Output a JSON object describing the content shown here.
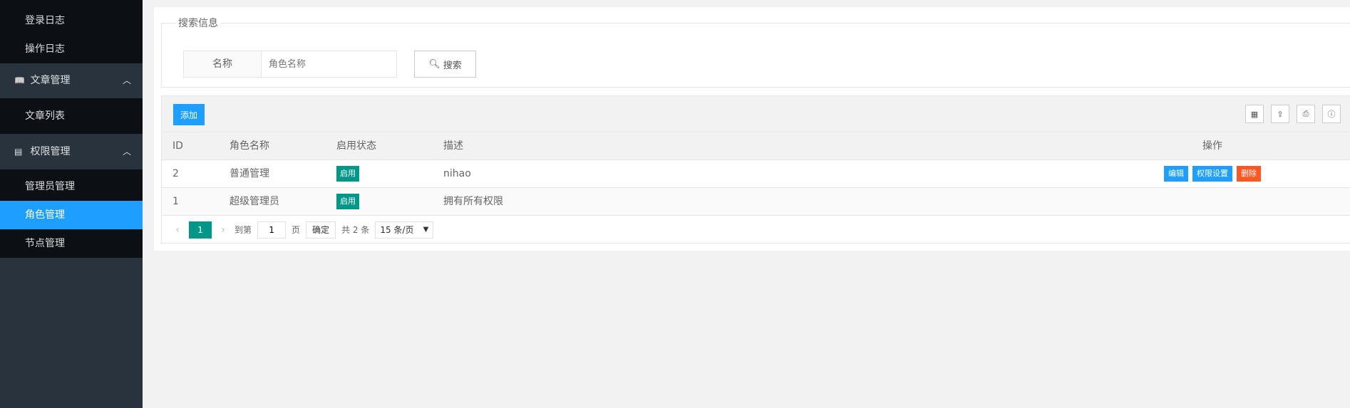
{
  "sidebar": {
    "top_items": [
      "登录日志",
      "操作日志"
    ],
    "groups": [
      {
        "label": "文章管理",
        "icon": "book-icon",
        "items": [
          "文章列表"
        ]
      },
      {
        "label": "权限管理",
        "icon": "list-icon",
        "items": [
          "管理员管理",
          "角色管理",
          "节点管理"
        ]
      }
    ],
    "active_item": "角色管理"
  },
  "search": {
    "legend": "搜索信息",
    "name_label": "名称",
    "placeholder": "角色名称",
    "button": "搜索"
  },
  "toolbar": {
    "add": "添加"
  },
  "table": {
    "headers": [
      "ID",
      "角色名称",
      "启用状态",
      "描述",
      "操作"
    ],
    "rows": [
      {
        "id": "2",
        "name": "普通管理",
        "status": "启用",
        "desc": "nihao",
        "ops": [
          "编辑",
          "权限设置",
          "删除"
        ]
      },
      {
        "id": "1",
        "name": "超级管理员",
        "status": "启用",
        "desc": "拥有所有权限",
        "ops": []
      }
    ]
  },
  "pager": {
    "current": "1",
    "goto_label": "到第",
    "goto_value": "1",
    "page_label": "页",
    "confirm": "确定",
    "total": "共 2 条",
    "per_page": "15 条/页"
  },
  "colors": {
    "primary": "#1e9fff",
    "green": "#009688",
    "danger": "#ff5722",
    "sidebar": "#28333e"
  }
}
